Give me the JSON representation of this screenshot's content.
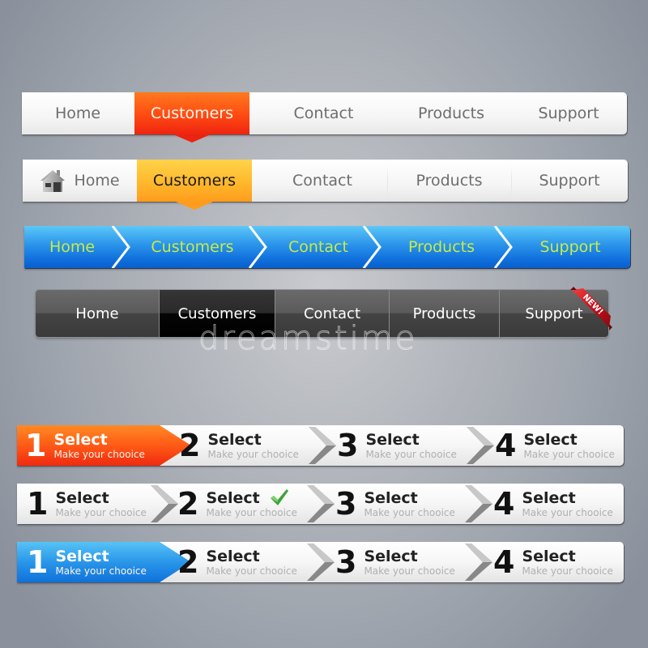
{
  "nav_bars": [
    {
      "style": "white-orange",
      "accent_color": "#ff4a12",
      "active_index": 1,
      "items": [
        {
          "label": "Home"
        },
        {
          "label": "Customers"
        },
        {
          "label": "Contact"
        },
        {
          "label": "Products"
        },
        {
          "label": "Support"
        }
      ]
    },
    {
      "style": "white-yellow-home-icon",
      "accent_color": "#ffb82c",
      "active_index": 1,
      "items": [
        {
          "label": "Home",
          "icon": "house-icon"
        },
        {
          "label": "Customers"
        },
        {
          "label": "Contact"
        },
        {
          "label": "Products"
        },
        {
          "label": "Support"
        }
      ]
    },
    {
      "style": "blue-breadcrumb",
      "accent_color": "#1a7fe2",
      "text_color": "#c6ec45",
      "items": [
        {
          "label": "Home"
        },
        {
          "label": "Customers"
        },
        {
          "label": "Contact"
        },
        {
          "label": "Products"
        },
        {
          "label": "Support"
        }
      ]
    },
    {
      "style": "dark",
      "accent_color": "#000000",
      "active_index": 1,
      "items": [
        {
          "label": "Home"
        },
        {
          "label": "Customers"
        },
        {
          "label": "Contact"
        },
        {
          "label": "Products"
        },
        {
          "label": "Support"
        }
      ],
      "badge": {
        "label": "NEW!",
        "color": "#d8141a"
      }
    }
  ],
  "watermark": "dreamstime",
  "step_bars": [
    {
      "style": "orange",
      "accent_color": "#ff5a16",
      "active_step": 1,
      "steps": [
        {
          "number": "1",
          "title": "Select",
          "subtitle": "Make your chooice"
        },
        {
          "number": "2",
          "title": "Select",
          "subtitle": "Make your chooice"
        },
        {
          "number": "3",
          "title": "Select",
          "subtitle": "Make your chooice"
        },
        {
          "number": "4",
          "title": "Select",
          "subtitle": "Make your chooice"
        }
      ]
    },
    {
      "style": "white-check",
      "completed_step": 2,
      "check_color": "#3ca23a",
      "steps": [
        {
          "number": "1",
          "title": "Select",
          "subtitle": "Make your chooice"
        },
        {
          "number": "2",
          "title": "Select",
          "subtitle": "Make your chooice",
          "icon": "checkmark-icon"
        },
        {
          "number": "3",
          "title": "Select",
          "subtitle": "Make your chooice"
        },
        {
          "number": "4",
          "title": "Select",
          "subtitle": "Make your chooice"
        }
      ]
    },
    {
      "style": "blue",
      "accent_color": "#2996e9",
      "active_step": 1,
      "steps": [
        {
          "number": "1",
          "title": "Select",
          "subtitle": "Make your chooice"
        },
        {
          "number": "2",
          "title": "Select",
          "subtitle": "Make your chooice"
        },
        {
          "number": "3",
          "title": "Select",
          "subtitle": "Make your chooice"
        },
        {
          "number": "4",
          "title": "Select",
          "subtitle": "Make your chooice"
        }
      ]
    }
  ]
}
